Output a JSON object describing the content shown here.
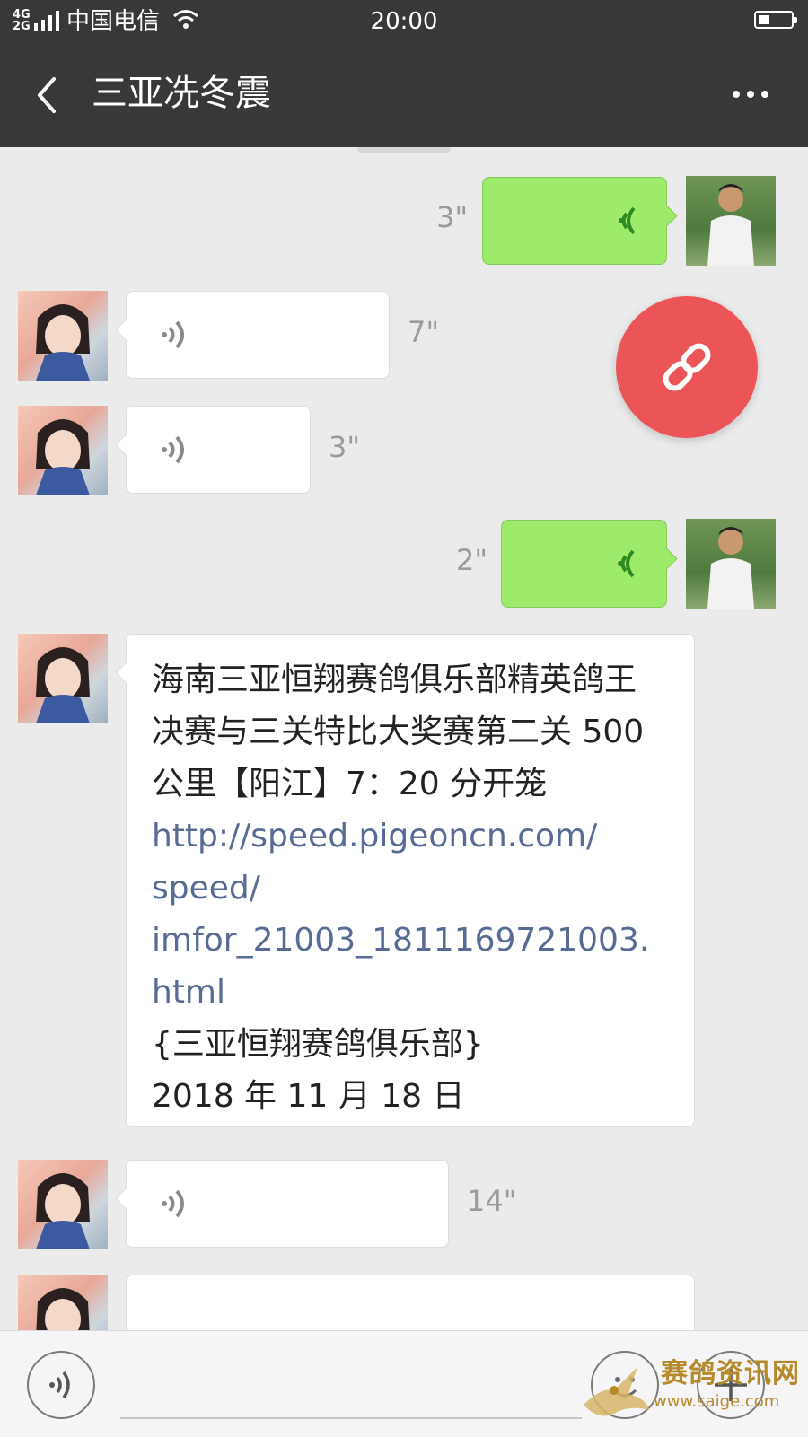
{
  "status_bar": {
    "network": "4G 2G",
    "carrier": "中国电信",
    "time": "20:00"
  },
  "header": {
    "title": "三亚冼冬震"
  },
  "messages": [
    {
      "direction": "out",
      "type": "voice",
      "duration": "3\""
    },
    {
      "direction": "in",
      "type": "voice",
      "duration": "7\""
    },
    {
      "direction": "in",
      "type": "voice",
      "duration": "3\""
    },
    {
      "direction": "out",
      "type": "voice",
      "duration": "2\""
    },
    {
      "direction": "in",
      "type": "text",
      "lines": [
        "海南三亚恒翔赛鸽俱乐部精英鸽王",
        "决赛与三关特比大奖赛第二关 500",
        "公里【阳江】7：20 分开笼"
      ],
      "link_lines": [
        "http://speed.pigeoncn.com/",
        "speed/",
        "imfor_21003_1811169721003.",
        "html"
      ],
      "after_lines": [
        "{三亚恒翔赛鸽俱乐部}",
        "2018 年 11 月 18 日"
      ]
    },
    {
      "direction": "in",
      "type": "voice",
      "duration": "14\""
    }
  ],
  "floating_button": {
    "icon": "link-icon",
    "color": "#ec5557"
  },
  "watermark": {
    "name": "赛鸽资讯网",
    "url": "www.saige.com"
  },
  "colors": {
    "bar_bg": "#383838",
    "chat_bg": "#ebebeb",
    "out_bubble": "#9eea6a",
    "in_bubble": "#ffffff",
    "link": "#576b95"
  }
}
